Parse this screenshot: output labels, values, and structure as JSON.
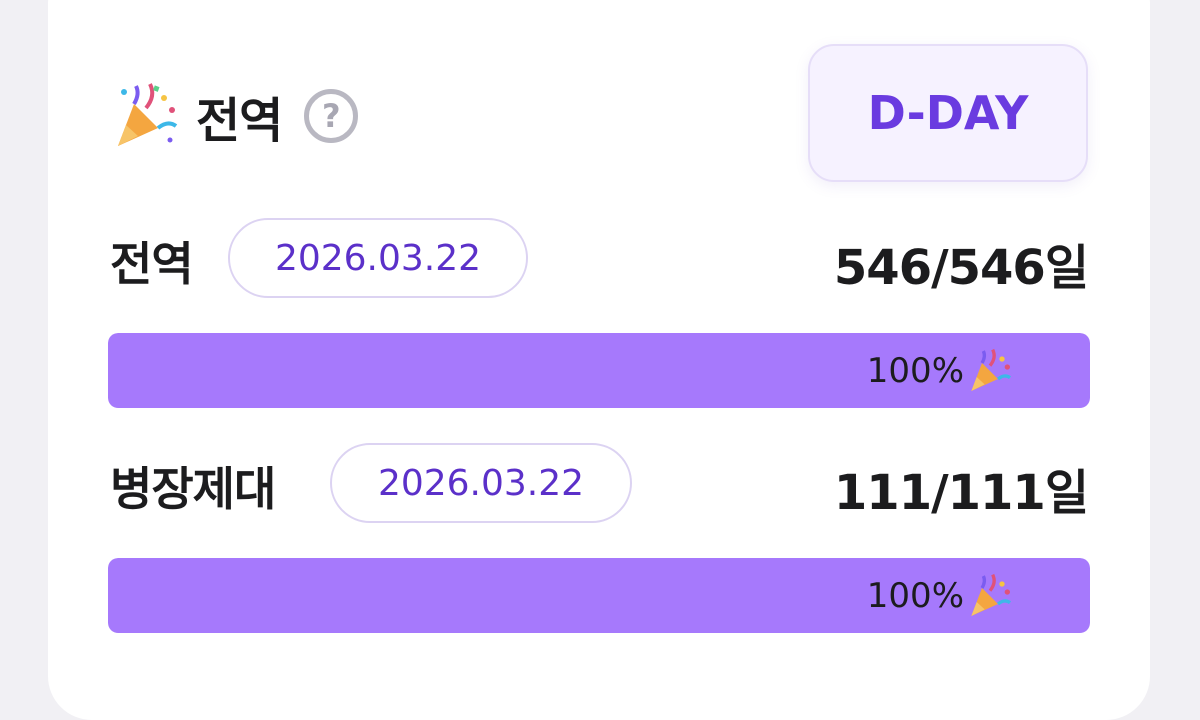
{
  "header": {
    "title": "전역",
    "help_icon": "help-circle-icon",
    "party_icon": "party-popper-icon"
  },
  "dday_button": {
    "label": "D-DAY"
  },
  "rows": [
    {
      "label": "전역",
      "date": "2026.03.22",
      "count": "546/546일",
      "progress_text": "100%",
      "progress_fraction": 1.0
    },
    {
      "label": "병장제대",
      "date": "2026.03.22",
      "count": "111/111일",
      "progress_text": "100%",
      "progress_fraction": 1.0
    }
  ],
  "colors": {
    "accent": "#6a3be0",
    "bar_fill": "#a679fc",
    "bar_track": "#ede7fb",
    "pill_text": "#5b30c9"
  }
}
